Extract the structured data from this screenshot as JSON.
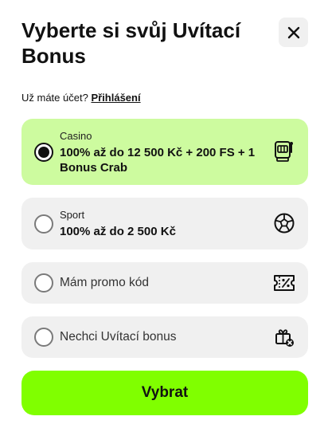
{
  "modal": {
    "title": "Vyberte si svůj Uvítací Bonus",
    "close_icon": "close-icon"
  },
  "login": {
    "prompt": "Už máte účet?",
    "link": "Přihlášení"
  },
  "options": [
    {
      "label": "Casino",
      "value": "100% až do 12 500 Kč + 200 FS + 1 Bonus Crab",
      "icon": "slot-machine-icon",
      "selected": true
    },
    {
      "label": "Sport",
      "value": "100% až do 2 500 Kč",
      "icon": "football-icon",
      "selected": false
    },
    {
      "label": "Mám promo kód",
      "icon": "promo-ticket-icon",
      "selected": false
    },
    {
      "label": "Nechci Uvítací bonus",
      "icon": "gift-cancel-icon",
      "selected": false
    }
  ],
  "submit": {
    "label": "Vybrat"
  },
  "colors": {
    "accent": "#80ff00",
    "selected_bg": "#cdfb9f",
    "option_bg": "#f0f0f0",
    "text": "#111111"
  }
}
